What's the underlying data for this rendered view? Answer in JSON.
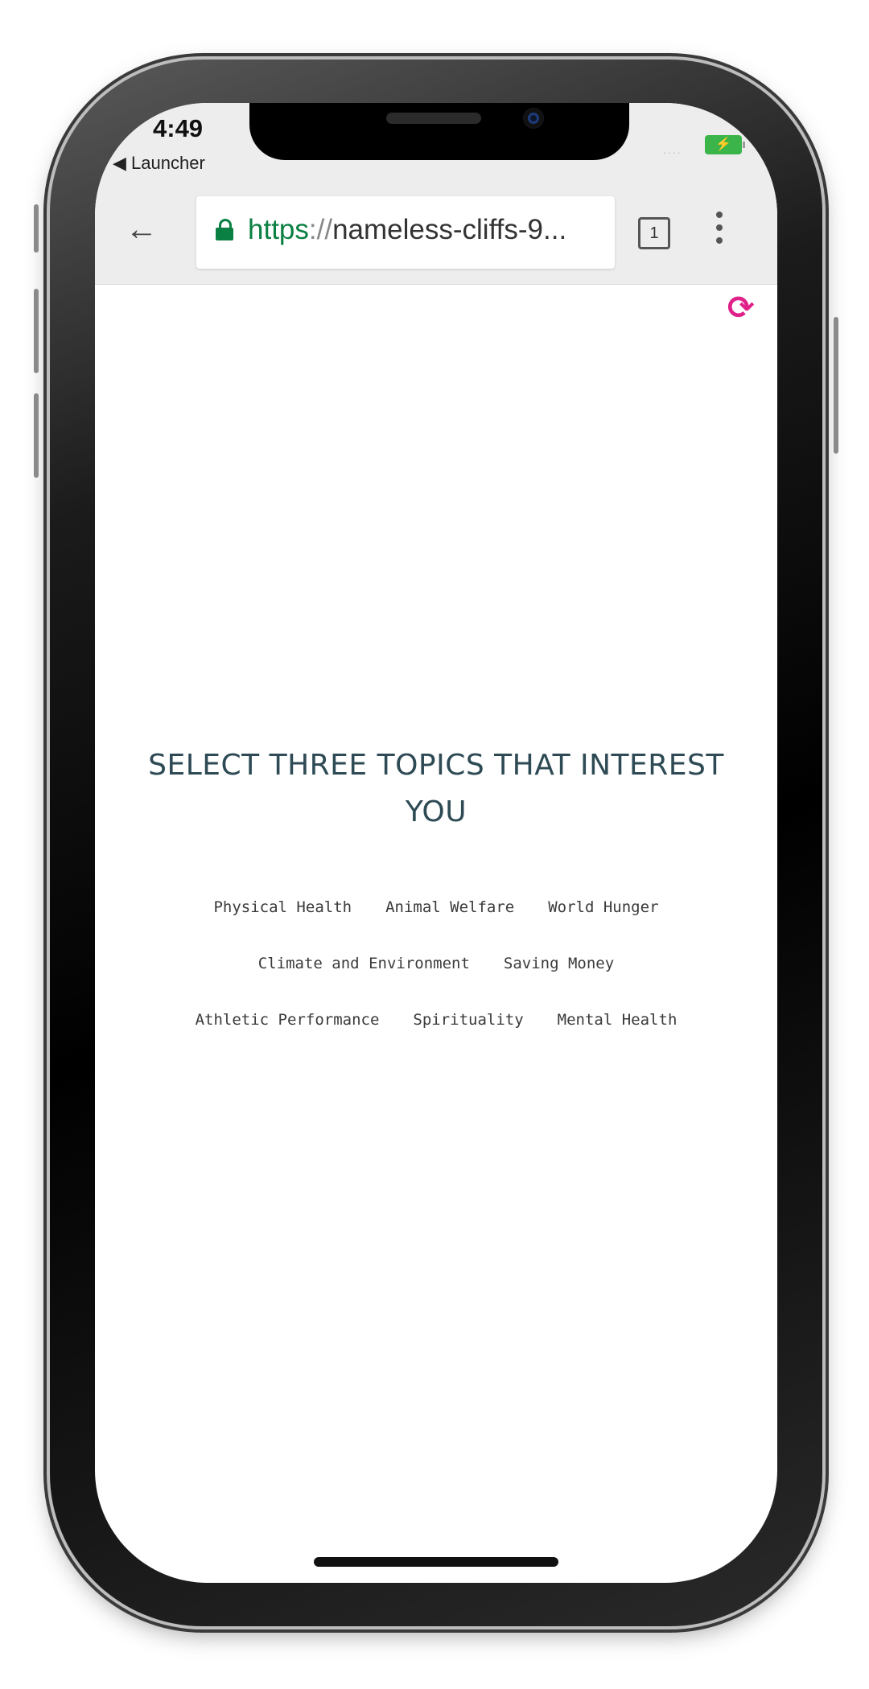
{
  "status_bar": {
    "time": "4:49",
    "back_app": "◀ Launcher",
    "signal": "....",
    "battery_icon": "⚡"
  },
  "browser": {
    "back_glyph": "←",
    "url_scheme": "https",
    "url_sep": "://",
    "url_host": "nameless-cliffs-9...",
    "tab_count": "1"
  },
  "page": {
    "refresh_glyph": "⟳",
    "refresh_color": "#e0218a",
    "heading_line1": "SELECT THREE TOPICS THAT INTEREST",
    "heading_line2": "YOU",
    "topic_rows": [
      [
        "Physical Health",
        "Animal Welfare",
        "World Hunger"
      ],
      [
        "Climate and Environment",
        "Saving Money"
      ],
      [
        "Athletic Performance",
        "Spirituality",
        "Mental Health"
      ]
    ]
  },
  "colors": {
    "heading": "#2e4a55",
    "secure_green": "#0b8043"
  }
}
